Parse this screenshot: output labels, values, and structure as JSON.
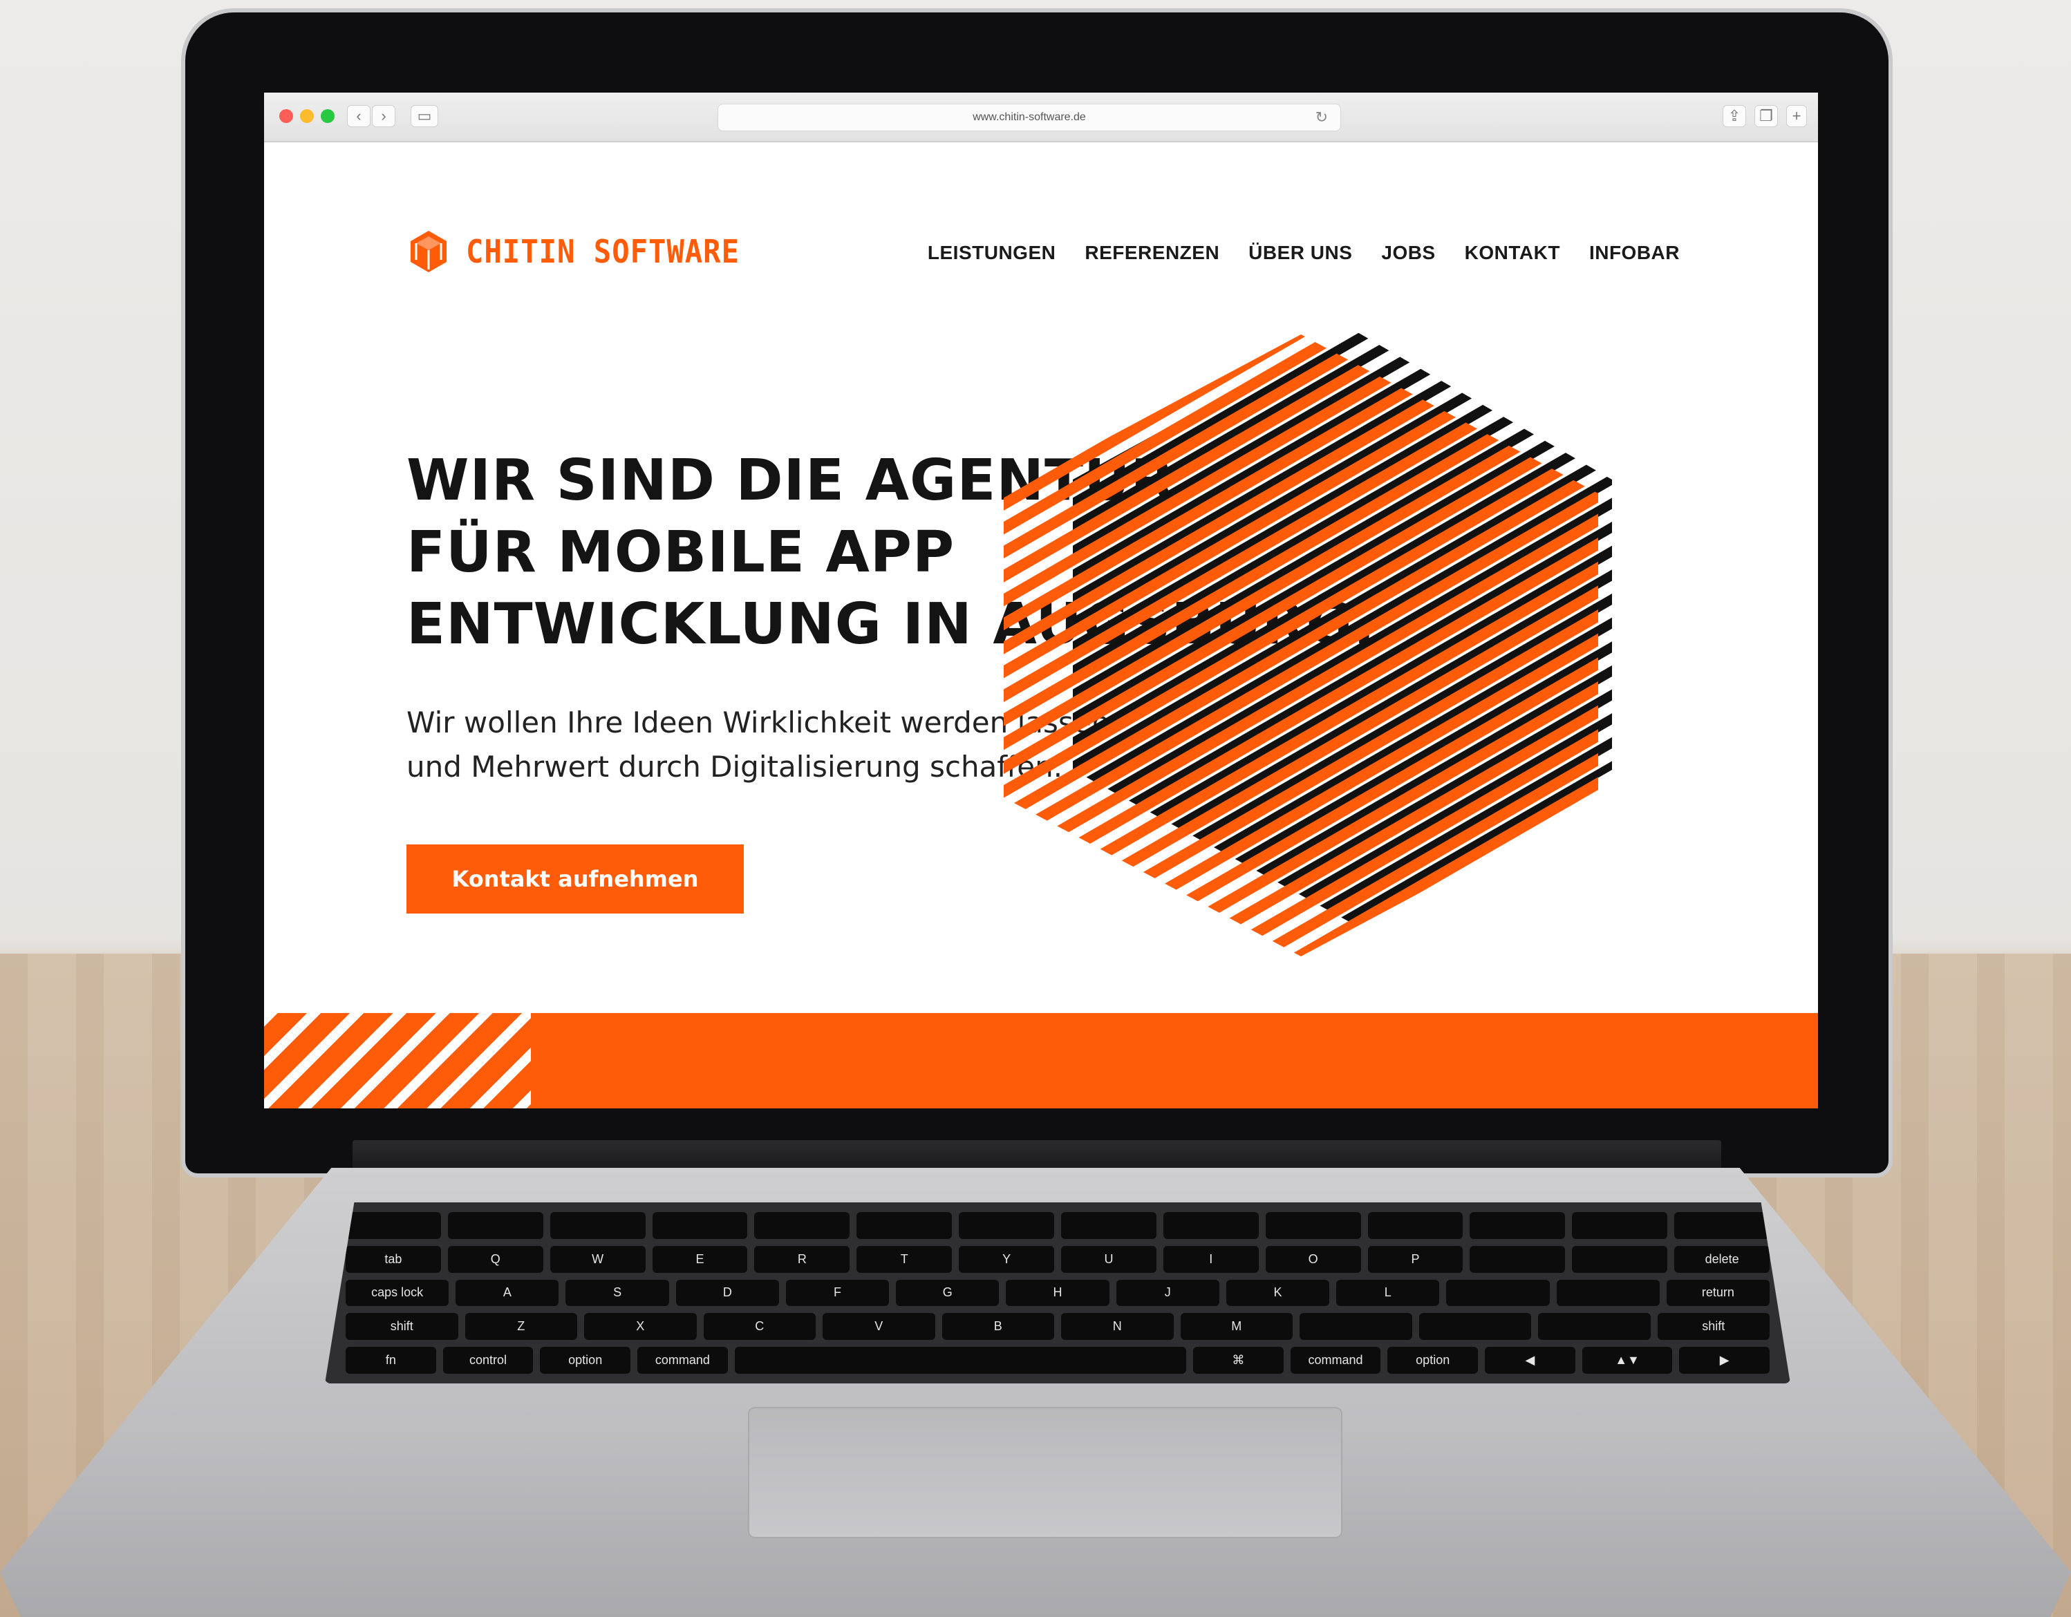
{
  "browser": {
    "url": "www.chitin-software.de"
  },
  "site": {
    "logo_text": "CHITIN SOFTWARE",
    "brand_color": "#ff5c0a",
    "nav": [
      "LEISTUNGEN",
      "REFERENZEN",
      "ÜBER UNS",
      "JOBS",
      "KONTAKT",
      "INFOBAR"
    ],
    "hero_title": [
      "WIR SIND DIE AGENTUR",
      "FÜR MOBILE APP",
      "ENTWICKLUNG IN AUGSBURG."
    ],
    "hero_subtitle": [
      "Wir wollen Ihre Ideen Wirklichkeit werden lassen",
      "und Mehrwert durch Digitalisierung schaffen."
    ],
    "cta_label": "Kontakt aufnehmen"
  },
  "keyboard": {
    "labels": [
      "tab",
      "caps lock",
      "shift",
      "fn",
      "control",
      "option",
      "command",
      "⌘",
      "command",
      "option",
      "delete",
      "return",
      "shift",
      "Q",
      "W",
      "E",
      "R",
      "T",
      "Y",
      "U",
      "I",
      "O",
      "P",
      "A",
      "S",
      "D",
      "F",
      "G",
      "H",
      "J",
      "K",
      "L",
      "Z",
      "X",
      "C",
      "V",
      "B",
      "N",
      "M"
    ]
  }
}
